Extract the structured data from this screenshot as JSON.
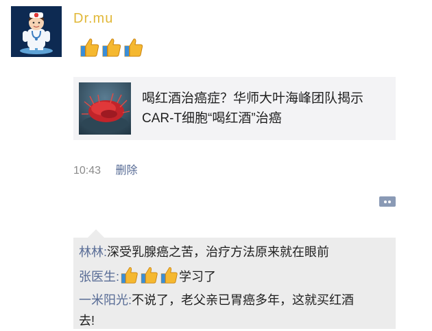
{
  "post": {
    "author": "Dr.mu",
    "content_icons": [
      "thumbs-up-icon",
      "thumbs-up-icon",
      "thumbs-up-icon"
    ],
    "article": {
      "title_line1": "喝红酒治癌症？华师大叶海峰团队揭示",
      "title_line2": "CAR-T细胞“喝红酒”治癌"
    },
    "time": "10:43",
    "delete_label": "删除"
  },
  "comments": [
    {
      "name": "林林:",
      "text": "深受乳腺癌之苦，治疗方法原来就在眼前"
    },
    {
      "name": "张医生:",
      "icons": [
        "thumbs-up-icon",
        "thumbs-up-icon",
        "thumbs-up-icon"
      ],
      "text": "学习了"
    },
    {
      "name": "一米阳光:",
      "text_line1": "不说了，老父亲已胃癌多年，这就买红酒",
      "text_line2": "去!"
    }
  ],
  "colors": {
    "author": "#e1b838",
    "link": "#576b95",
    "comment_bg": "#ececec",
    "card_bg": "#f3f3f5",
    "thumbs": "#f5b830"
  }
}
